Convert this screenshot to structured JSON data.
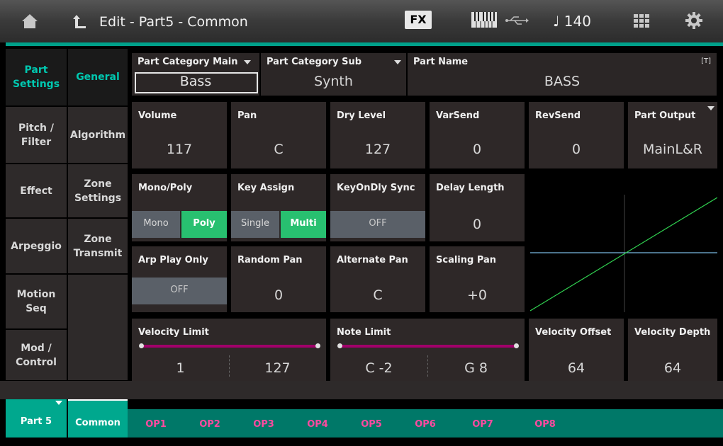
{
  "header": {
    "title": "Edit - Part5 - Common",
    "fx_label": "FX",
    "tempo": "♩ 140"
  },
  "icons": {
    "home": "home-icon",
    "back": "back-arrow-icon",
    "keyboard": "keyboard-icon",
    "usb": "usb-icon",
    "grid": "grid-icon",
    "gear": "gear-icon"
  },
  "colors": {
    "accent": "#00c8b0",
    "teal": "#00a08a",
    "on": "#28c070",
    "off": "#5a6068",
    "magenta": "#ff4aa0",
    "bar": "#a0006a"
  },
  "left_tabs": [
    {
      "label": "Part\nSettings"
    },
    {
      "label": "Pitch /\nFilter"
    },
    {
      "label": "Effect"
    },
    {
      "label": "Arpeggio"
    },
    {
      "label": "Motion\nSeq"
    },
    {
      "label": "Mod /\nControl"
    }
  ],
  "sub_tabs": [
    {
      "label": "General"
    },
    {
      "label": "Algorithm"
    },
    {
      "label": "Zone\nSettings"
    },
    {
      "label": "Zone\nTransmit"
    }
  ],
  "part_info": {
    "category_main": {
      "label": "Part Category Main",
      "value": "Bass"
    },
    "category_sub": {
      "label": "Part Category Sub",
      "value": "Synth"
    },
    "part_name": {
      "label": "Part Name",
      "value": "BASS",
      "flag": "[T]"
    }
  },
  "row1": {
    "volume": {
      "label": "Volume",
      "value": "117"
    },
    "pan": {
      "label": "Pan",
      "value": "C"
    },
    "dry_level": {
      "label": "Dry Level",
      "value": "127"
    },
    "var_send": {
      "label": "VarSend",
      "value": "0"
    },
    "rev_send": {
      "label": "RevSend",
      "value": "0"
    },
    "part_output": {
      "label": "Part Output",
      "value": "MainL&R"
    }
  },
  "row2": {
    "mono_poly": {
      "label": "Mono/Poly",
      "opt1": "Mono",
      "opt2": "Poly",
      "selected": "Poly"
    },
    "key_assign": {
      "label": "Key Assign",
      "opt1": "Single",
      "opt2": "Multi",
      "selected": "Multi"
    },
    "keyon_dly_sync": {
      "label": "KeyOnDly Sync",
      "value": "OFF"
    },
    "delay_length": {
      "label": "Delay Length",
      "value": "0"
    }
  },
  "row3": {
    "arp_play_only": {
      "label": "Arp Play Only",
      "value": "OFF"
    },
    "random_pan": {
      "label": "Random Pan",
      "value": "0"
    },
    "alternate_pan": {
      "label": "Alternate Pan",
      "value": "C"
    },
    "scaling_pan": {
      "label": "Scaling Pan",
      "value": "+0"
    }
  },
  "row4": {
    "velocity_limit": {
      "label": "Velocity Limit",
      "low": "1",
      "high": "127"
    },
    "note_limit": {
      "label": "Note Limit",
      "low": "C -2",
      "high": "G 8"
    },
    "velocity_offset": {
      "label": "Velocity Offset",
      "value": "64"
    },
    "velocity_depth": {
      "label": "Velocity Depth",
      "value": "64"
    }
  },
  "bottom": {
    "part": "Part 5",
    "common": "Common",
    "ops": [
      "OP1",
      "OP2",
      "OP3",
      "OP4",
      "OP5",
      "OP6",
      "OP7",
      "OP8"
    ]
  }
}
